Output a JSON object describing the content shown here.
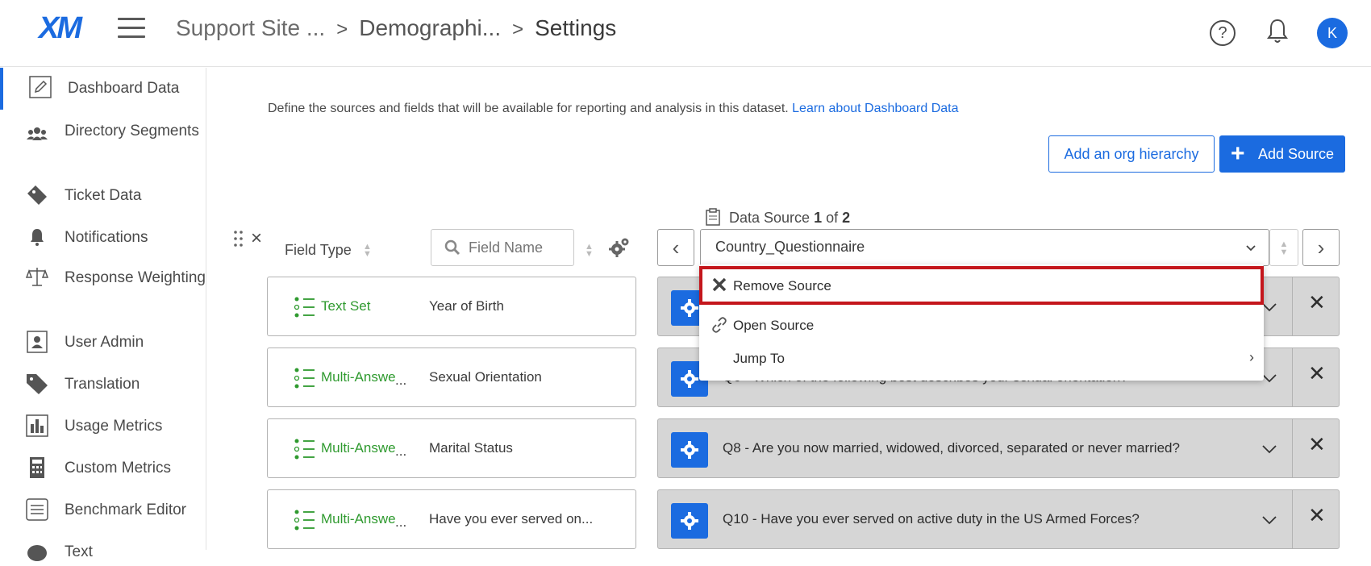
{
  "header": {
    "logo": "XM",
    "breadcrumbs": [
      "Support Site ...",
      "Demographi...",
      "Settings"
    ],
    "avatar_initial": "K"
  },
  "sidebar": {
    "items": [
      {
        "label": "Dashboard Data",
        "icon": "pencil-icon",
        "active": true
      },
      {
        "label": "Directory Segments",
        "icon": "people-icon"
      },
      {
        "label": "Ticket Data",
        "icon": "ticket-icon"
      },
      {
        "label": "Notifications",
        "icon": "bell-icon"
      },
      {
        "label": "Response Weighting",
        "icon": "scale-icon"
      },
      {
        "label": "User Admin",
        "icon": "user-card-icon"
      },
      {
        "label": "Translation",
        "icon": "tag-icon"
      },
      {
        "label": "Usage Metrics",
        "icon": "bar-chart-icon"
      },
      {
        "label": "Custom Metrics",
        "icon": "calculator-icon"
      },
      {
        "label": "Benchmark Editor",
        "icon": "list-icon"
      },
      {
        "label": "Text",
        "icon": "text-icon"
      }
    ]
  },
  "main": {
    "description": "Define the sources and fields that will be available for reporting and analysis in this dataset.",
    "learn_link": "Learn about Dashboard Data",
    "add_org_hierarchy": "Add an org hierarchy",
    "add_source": "Add Source",
    "data_source_label": "Data Source",
    "data_source_index": "1",
    "data_source_of": "of",
    "data_source_total": "2",
    "field_type_header": "Field Type",
    "field_name_placeholder": "Field Name",
    "selected_source": "Country_Questionnaire"
  },
  "fields": [
    {
      "type": "Text Set",
      "dots": "",
      "name": "Year of Birth",
      "question": ""
    },
    {
      "type": "Multi-Answe",
      "dots": "...",
      "name": "Sexual Orientation",
      "question": "Q6 - Which of the following best describes your sexual orientation?"
    },
    {
      "type": "Multi-Answe",
      "dots": "...",
      "name": "Marital Status",
      "question": "Q8 - Are you now married, widowed, divorced, separated or never married?"
    },
    {
      "type": "Multi-Answe",
      "dots": "...",
      "name": "Have you ever served on...",
      "question": "Q10 - Have you ever served on active duty in the US Armed Forces?"
    }
  ],
  "dropdown": {
    "remove_source": "Remove Source",
    "open_source": "Open Source",
    "jump_to": "Jump To"
  },
  "colors": {
    "accent": "#1b6be0",
    "field_type_green": "#2f9a2f",
    "highlight_red": "#c4161c",
    "card_gray": "#d6d6d6"
  }
}
